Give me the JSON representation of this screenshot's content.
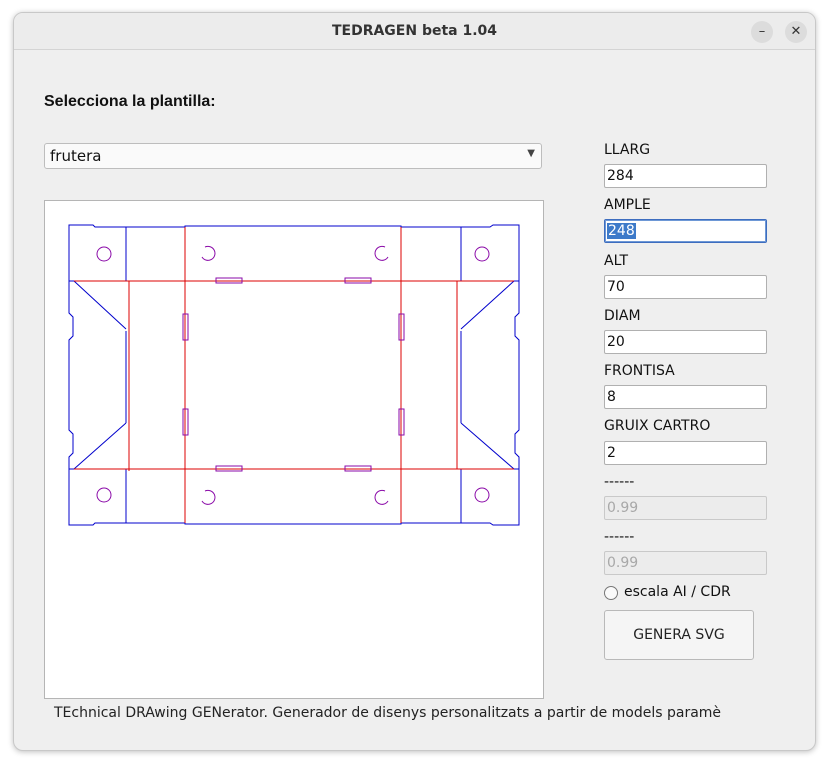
{
  "window": {
    "title": "TEDRAGEN beta 1.04",
    "minimize": "–",
    "close": "✕"
  },
  "heading": "Selecciona la plantilla:",
  "template_select": {
    "value": "frutera",
    "arrow": "▼"
  },
  "fields": [
    {
      "label": "LLARG",
      "value": "284"
    },
    {
      "label": "AMPLE",
      "value": "248"
    },
    {
      "label": "ALT",
      "value": "70"
    },
    {
      "label": "DIAM",
      "value": "20"
    },
    {
      "label": "FRONTISA",
      "value": "8"
    },
    {
      "label": "GRUIX CARTRO",
      "value": "2"
    },
    {
      "label": "------",
      "value": "0.99"
    },
    {
      "label": "------",
      "value": "0.99"
    }
  ],
  "scale_option": "escala AI / CDR",
  "generate_button": "GENERA SVG",
  "status_text": "TEchnical DRAwing GENerator. Generador de disenys personalitzats a partir de models paramè",
  "colors": {
    "cut_lines": "#0000cc",
    "fold_lines": "#dd0000",
    "holes": "#8a0aa8"
  }
}
